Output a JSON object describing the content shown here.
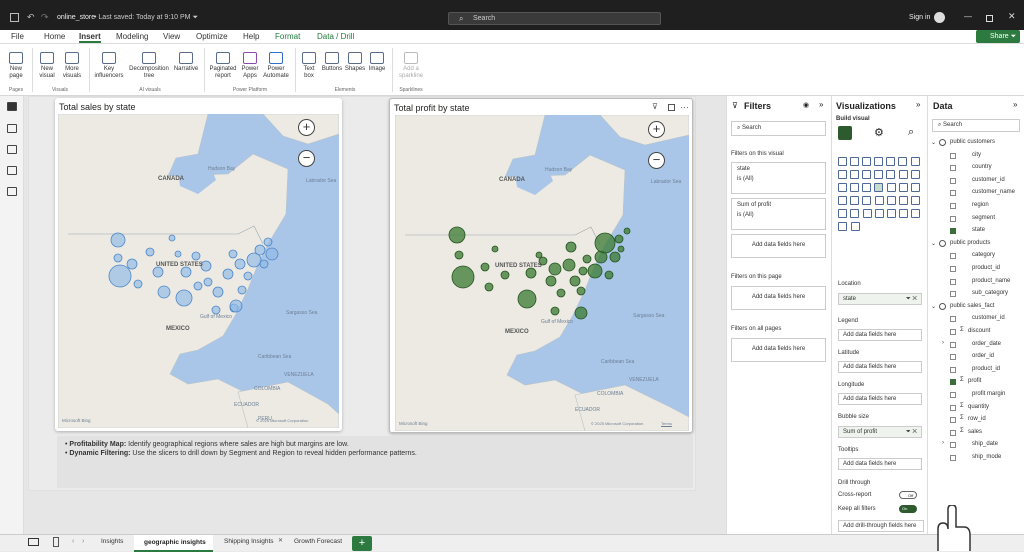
{
  "titlebar": {
    "filename": "online_store",
    "saved": "Last saved: Today at 9:10 PM",
    "search_placeholder": "Search",
    "signin": "Sign in"
  },
  "menu": {
    "items": [
      "File",
      "Home",
      "Insert",
      "Modeling",
      "View",
      "Optimize",
      "Help",
      "Format",
      "Data / Drill"
    ],
    "active": "Insert",
    "share": "Share"
  },
  "ribbon": {
    "pages": {
      "new_page": "New page",
      "group": "Pages"
    },
    "visuals": {
      "new_visual": "New visual",
      "more_visuals": "More visuals",
      "group": "Visuals"
    },
    "ai": {
      "key_influencers": "Key influencers",
      "decomposition": "Decomposition tree",
      "narrative": "Narrative",
      "group": "AI visuals"
    },
    "power": {
      "paginated": "Paginated report",
      "powerapps": "Power Apps",
      "automate": "Power Automate",
      "group": "Power Platform"
    },
    "elements": {
      "textbox": "Text box",
      "buttons": "Buttons",
      "shapes": "Shapes",
      "image": "Image",
      "group": "Elements"
    },
    "sparklines": {
      "add": "Add a sparkline",
      "group": "Sparklines"
    }
  },
  "visuals": [
    {
      "title": "Total sales by state",
      "color": "#8fb8e6"
    },
    {
      "title": "Total profit by state",
      "color": "#3a7a32"
    }
  ],
  "map_labels": {
    "canada": "CANADA",
    "us": "UNITED STATES",
    "mexico": "MEXICO",
    "hudson": "Hudson Bay",
    "labrador": "Labrador Sea",
    "gulf": "Gulf of Mexico",
    "sargasso": "Sargasso Sea",
    "caribbean": "Caribbean Sea",
    "venezuela": "VENEZUELA",
    "colombia": "COLOMBIA",
    "ecuador": "ECUADOR",
    "peru": "PERU",
    "bing": "Microsoft Bing",
    "copyright": "© 2025 Microsoft Corporation",
    "terms": "Terms"
  },
  "notes": [
    {
      "bold": "Profitability Map:",
      "text": " Identify geographical regions where sales are high but margins are low."
    },
    {
      "bold": "Dynamic Filtering:",
      "text": " Use the slicers to drill down by Segment and Region to reveal hidden performance patterns."
    }
  ],
  "filters": {
    "title": "Filters",
    "search": "Search",
    "on_visual": "Filters on this visual",
    "state": "state",
    "state_val": "is (All)",
    "profit": "Sum of profit",
    "profit_val": "is (All)",
    "add": "Add data fields here",
    "on_page": "Filters on this page",
    "on_all": "Filters on all pages"
  },
  "viz": {
    "title": "Visualizations",
    "build": "Build visual",
    "location": "Location",
    "location_val": "state",
    "legend": "Legend",
    "latitude": "Latitude",
    "longitude": "Longitude",
    "bubble": "Bubble size",
    "bubble_val": "Sum of profit",
    "tooltips": "Tooltips",
    "drill": "Drill through",
    "cross": "Cross-report",
    "cross_state": "Off",
    "keep": "Keep all filters",
    "keep_state": "On",
    "add": "Add data fields here",
    "add_drill": "Add drill-through fields here"
  },
  "data": {
    "title": "Data",
    "search": "Search",
    "tables": [
      {
        "name": "public customers",
        "fields": [
          {
            "n": "city"
          },
          {
            "n": "country"
          },
          {
            "n": "customer_id"
          },
          {
            "n": "customer_name"
          },
          {
            "n": "region"
          },
          {
            "n": "segment"
          },
          {
            "n": "state",
            "checked": true
          }
        ]
      },
      {
        "name": "public products",
        "fields": [
          {
            "n": "category"
          },
          {
            "n": "product_id"
          },
          {
            "n": "product_name"
          },
          {
            "n": "sub_category"
          }
        ]
      },
      {
        "name": "public sales_fact",
        "fields": [
          {
            "n": "customer_id"
          },
          {
            "n": "discount",
            "sigma": true
          },
          {
            "n": "order_date",
            "expand": true
          },
          {
            "n": "order_id"
          },
          {
            "n": "product_id"
          },
          {
            "n": "profit",
            "sigma": true,
            "checked": true
          },
          {
            "n": "profit margin"
          },
          {
            "n": "quantity",
            "sigma": true
          },
          {
            "n": "row_id",
            "sigma": true
          },
          {
            "n": "sales",
            "sigma": true
          },
          {
            "n": "ship_date",
            "expand": true
          },
          {
            "n": "ship_mode"
          }
        ]
      }
    ]
  },
  "tabs": [
    "Insights",
    "geographic insights",
    "Shipping Insights",
    "Growth Forecast"
  ],
  "active_tab": "geographic insights"
}
